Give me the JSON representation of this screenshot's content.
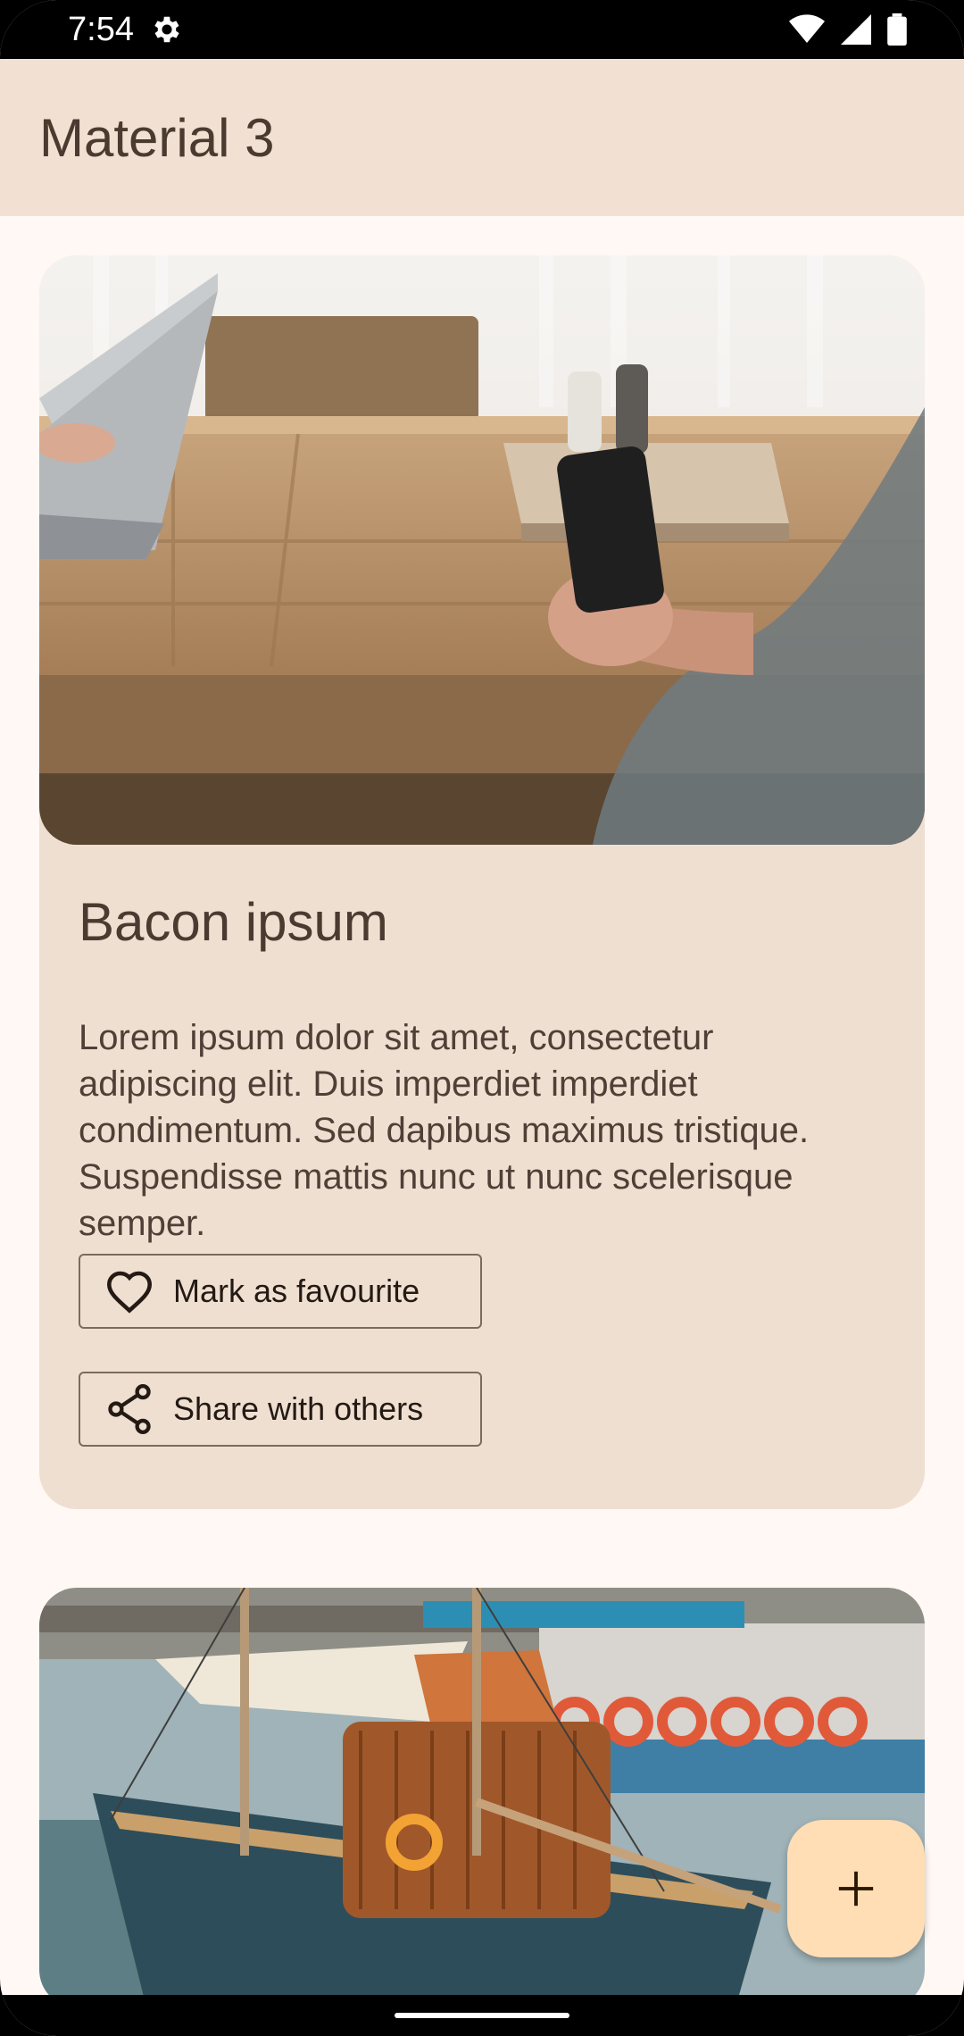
{
  "status_bar": {
    "time": "7:54",
    "icons": [
      "settings-icon",
      "wifi-icon",
      "signal-icon",
      "battery-icon"
    ]
  },
  "app_bar": {
    "title": "Material 3"
  },
  "cards": [
    {
      "image": "laptop-phone-table-photo",
      "title": "Bacon ipsum",
      "body": "Lorem ipsum dolor sit amet, consectetur adipiscing elit. Duis imperdiet imperdiet condimentum. Sed dapibus maximus tristique. Suspendisse mattis nunc ut nunc scelerisque semper.",
      "actions": [
        {
          "label": "Mark as favourite",
          "icon": "heart-outline-icon"
        },
        {
          "label": "Share with others",
          "icon": "share-icon"
        }
      ]
    },
    {
      "image": "sailboat-harbor-photo"
    }
  ],
  "fab": {
    "icon": "plus-icon"
  },
  "colors": {
    "surface": "#FFF8F4",
    "app_bar": "#F2E0D2",
    "card": "#EFDFD1",
    "fab": "#FFDDB5",
    "on_surface": "#4A3A30",
    "outline": "#7C6A5E"
  }
}
